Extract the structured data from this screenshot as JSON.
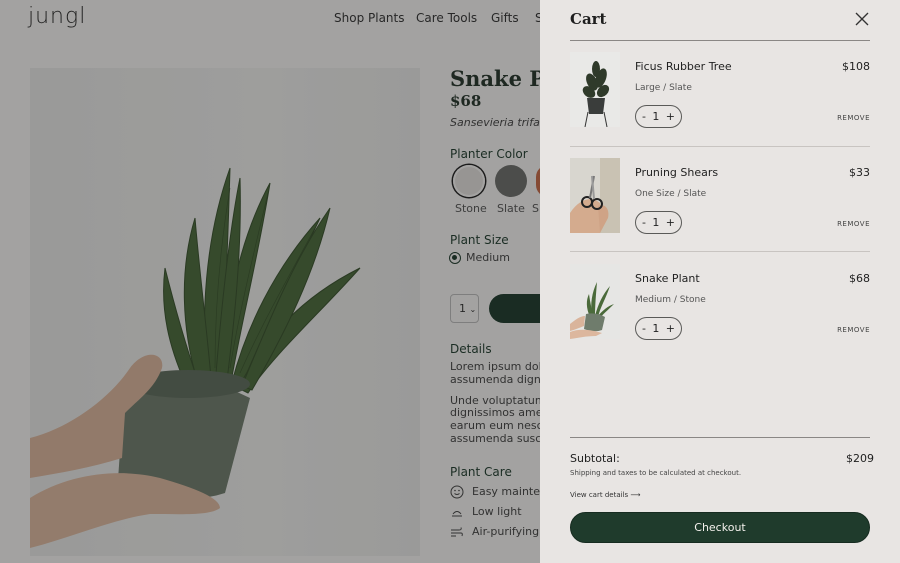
{
  "brand": {
    "logo": "jungl"
  },
  "nav": {
    "items": [
      "Shop Plants",
      "Care Tools",
      "Gifts",
      "S"
    ]
  },
  "product": {
    "title": "Snake Pla",
    "price": "$68",
    "latin": "Sansevieria trifas",
    "planter_color_label": "Planter Color",
    "swatches": [
      {
        "name": "Stone",
        "color": "#e2dfdb"
      },
      {
        "name": "Slate",
        "color": "#6d6e6b"
      },
      {
        "name": "S",
        "color": "#c56a47"
      }
    ],
    "size_label": "Plant Size",
    "size_value": "Medium",
    "qty_value": "1",
    "details_label": "Details",
    "details_lines": [
      "Lorem ipsum dolo",
      "assumenda digni",
      "Unde voluptatum",
      "dignissimos amet",
      "earum eum nescia",
      "assumenda suscip"
    ],
    "care_label": "Plant Care",
    "care_items": [
      "Easy mainten",
      "Low light",
      "Air-purifying"
    ]
  },
  "cart": {
    "title": "Cart",
    "items": [
      {
        "name": "Ficus Rubber Tree",
        "variant": "Large / Slate",
        "price": "$108",
        "qty": "1"
      },
      {
        "name": "Pruning Shears",
        "variant": "One Size / Slate",
        "price": "$33",
        "qty": "1"
      },
      {
        "name": "Snake Plant",
        "variant": "Medium / Stone",
        "price": "$68",
        "qty": "1"
      }
    ],
    "qty_minus": "-",
    "qty_plus": "+",
    "remove_label": "REMOVE",
    "subtotal_label": "Subtotal:",
    "subtotal_value": "$209",
    "shipping_note": "Shipping and taxes to be calculated at checkout.",
    "view_details": "View cart details ⟶",
    "checkout_label": "Checkout"
  },
  "colors": {
    "brand_green": "#1f3b2c",
    "drawer_bg": "#e8e5e3"
  }
}
